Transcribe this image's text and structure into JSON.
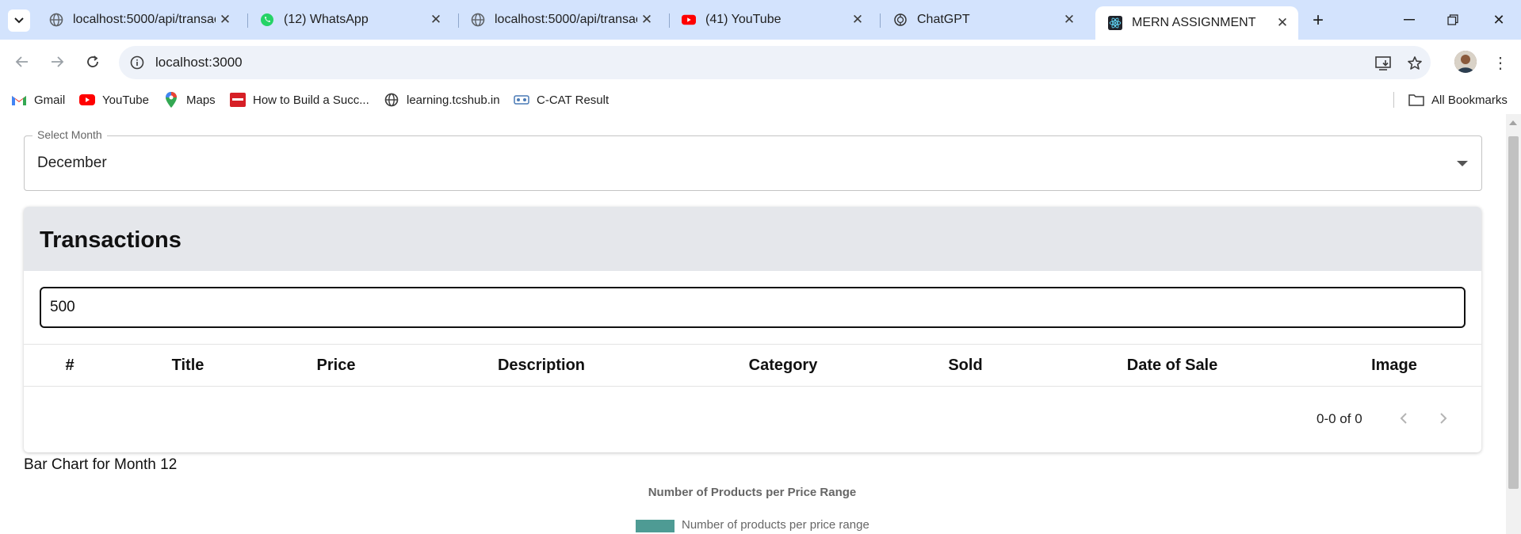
{
  "browser": {
    "tabs": [
      {
        "label": "localhost:5000/api/transacti",
        "icon": "globe-icon",
        "active": false
      },
      {
        "label": "(12) WhatsApp",
        "icon": "whatsapp-icon",
        "active": false
      },
      {
        "label": "localhost:5000/api/transacti",
        "icon": "globe-icon",
        "active": false
      },
      {
        "label": "(41) YouTube",
        "icon": "youtube-icon",
        "active": false
      },
      {
        "label": "ChatGPT",
        "icon": "chatgpt-icon",
        "active": false
      },
      {
        "label": "MERN ASSIGNMENT",
        "icon": "react-icon",
        "active": true
      }
    ],
    "address": "localhost:3000",
    "bookmarks": [
      {
        "label": "Gmail",
        "icon": "gmail-icon"
      },
      {
        "label": "YouTube",
        "icon": "youtube-icon"
      },
      {
        "label": "Maps",
        "icon": "maps-icon"
      },
      {
        "label": "How to Build a Succ...",
        "icon": "bookmark-site-icon"
      },
      {
        "label": "learning.tcshub.in",
        "icon": "globe-icon"
      },
      {
        "label": "C-CAT Result",
        "icon": "ccat-icon"
      }
    ],
    "all_bookmarks": "All Bookmarks"
  },
  "page": {
    "select": {
      "legend": "Select Month",
      "value": "December"
    },
    "transactions": {
      "title": "Transactions",
      "search_value": "500",
      "columns": [
        "#",
        "Title",
        "Price",
        "Description",
        "Category",
        "Sold",
        "Date of Sale",
        "Image"
      ],
      "rows": [],
      "pagination": "0-0 of 0"
    },
    "chart": {
      "heading": "Bar Chart for Month 12"
    }
  },
  "chart_data": {
    "type": "bar",
    "title": "Number of Products per Price Range",
    "series": [
      {
        "name": "Number of products per price range",
        "values": []
      }
    ],
    "legend_position": "top",
    "color": "#4e9b94"
  },
  "colors": {
    "tabbar": "#d3e3fd",
    "card_header": "#e5e7eb",
    "accent_bar": "#4e9b94"
  }
}
